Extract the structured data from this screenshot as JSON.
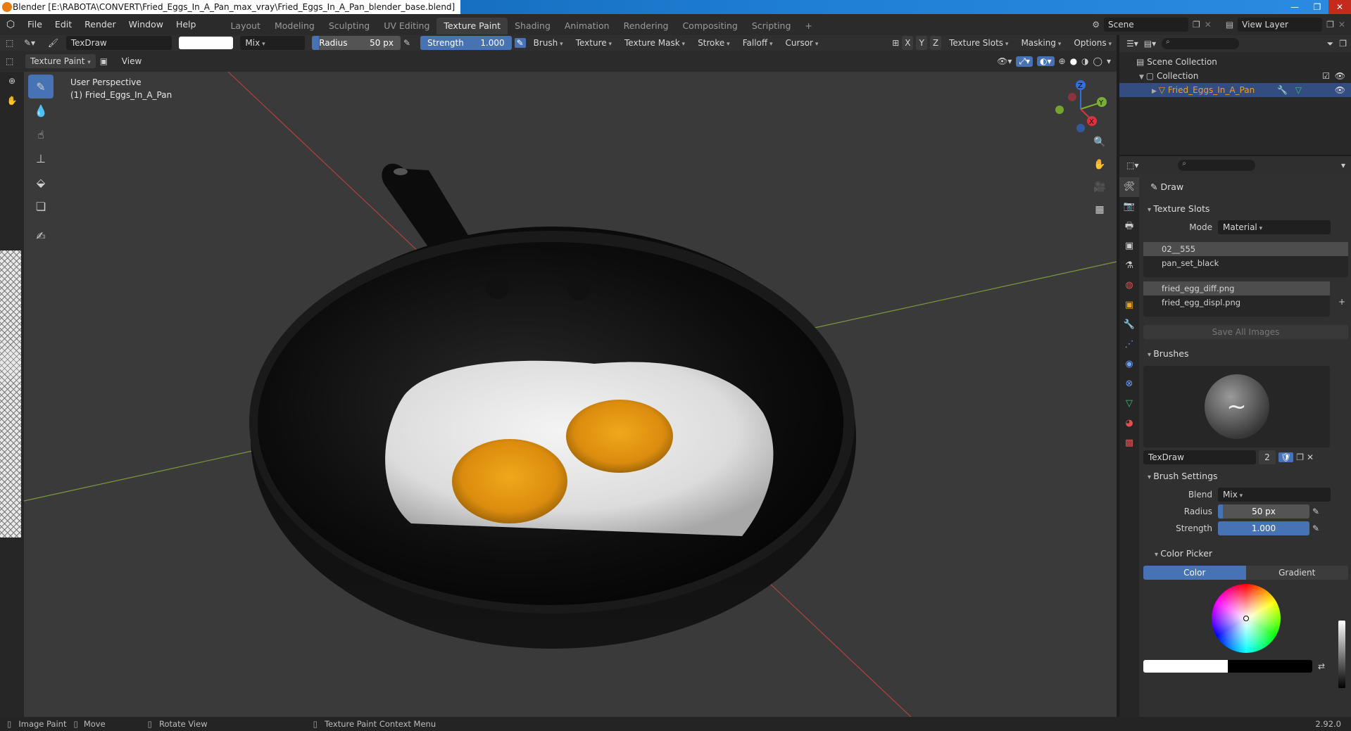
{
  "window": {
    "title": "Blender [E:\\RABOTA\\CONVERT\\Fried_Eggs_In_A_Pan_max_vray\\Fried_Eggs_In_A_Pan_blender_base.blend]"
  },
  "menu": [
    "File",
    "Edit",
    "Render",
    "Window",
    "Help"
  ],
  "workspaces": [
    "Layout",
    "Modeling",
    "Sculpting",
    "UV Editing",
    "Texture Paint",
    "Shading",
    "Animation",
    "Rendering",
    "Compositing",
    "Scripting"
  ],
  "active_workspace": "Texture Paint",
  "scene": {
    "scene_name": "Scene",
    "view_layer": "View Layer"
  },
  "tool_header": {
    "brush_name": "TexDraw",
    "blend": "Mix",
    "radius_label": "Radius",
    "radius_value": "50 px",
    "strength_label": "Strength",
    "strength_value": "1.000",
    "menus": [
      "Brush",
      "Texture",
      "Texture Mask",
      "Stroke",
      "Falloff",
      "Cursor"
    ],
    "axes": [
      "X",
      "Y",
      "Z"
    ],
    "right_menus": [
      "Texture Slots",
      "Masking",
      "Options"
    ]
  },
  "header2": {
    "mode": "Texture Paint",
    "view": "View"
  },
  "viewport": {
    "line1": "User Perspective",
    "line2": "(1) Fried_Eggs_In_A_Pan"
  },
  "gizmo": {
    "x": "X",
    "y": "Y",
    "z": "Z"
  },
  "outliner": {
    "scene_collection": "Scene Collection",
    "collection": "Collection",
    "object": "Fried_Eggs_In_A_Pan"
  },
  "properties": {
    "tool_name": "Draw",
    "texture_slots_title": "Texture Slots",
    "mode_label": "Mode",
    "mode_value": "Material",
    "materials": [
      "02__555",
      "pan_set_black"
    ],
    "images": [
      "fried_egg_diff.png",
      "fried_egg_displ.png"
    ],
    "save_all": "Save All Images",
    "brushes_title": "Brushes",
    "brush_name": "TexDraw",
    "brush_users": "2",
    "brush_settings_title": "Brush Settings",
    "blend_label": "Blend",
    "blend_value": "Mix",
    "radius_label": "Radius",
    "radius_value": "50 px",
    "strength_label": "Strength",
    "strength_value": "1.000",
    "color_picker_title": "Color Picker",
    "color_tab": "Color",
    "gradient_tab": "Gradient"
  },
  "statusbar": {
    "left1": "Image Paint",
    "left2": "Move",
    "left3": "Rotate View",
    "left4": "Texture Paint Context Menu",
    "version": "2.92.0"
  },
  "colors": {
    "accent": "#4772b3",
    "selected_row": "#334d80",
    "object_name": "#f0a020"
  }
}
